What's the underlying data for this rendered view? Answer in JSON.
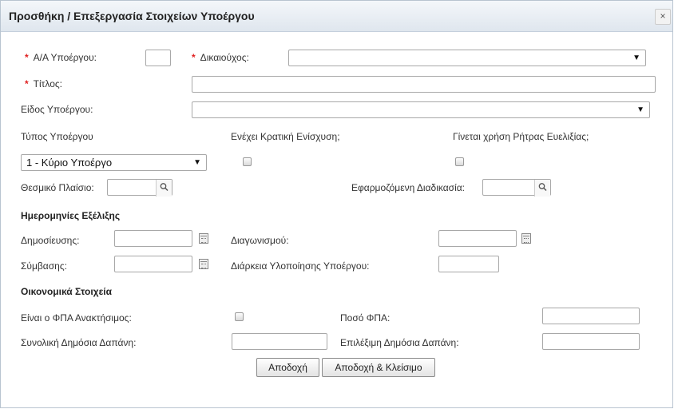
{
  "dialog": {
    "title": "Προσθήκη / Επεξεργασία Στοιχείων Υποέργου",
    "close": "×"
  },
  "fields": {
    "aa": {
      "label": "Α/Α Υποέργου:",
      "required": "*",
      "value": ""
    },
    "beneficiary": {
      "label": "Δικαιούχος:",
      "required": "*",
      "value": ""
    },
    "title": {
      "label": "Τίτλος:",
      "required": "*",
      "value": ""
    },
    "subproject_kind": {
      "label": "Είδος Υποέργου:",
      "value": ""
    },
    "subproject_type": {
      "label": "Τύπος Υποέργου",
      "value": "1 - Κύριο Υποέργο"
    },
    "state_aid": {
      "label": "Ενέχει Κρατική Ενίσχυση;",
      "checked": false
    },
    "flex_clause": {
      "label": "Γίνεται χρήση Ρήτρας Ευελιξίας;",
      "checked": false
    },
    "framework": {
      "label": "Θεσμικό Πλαίσιο:",
      "value": ""
    },
    "procedure": {
      "label": "Εφαρμοζόμενη Διαδικασία:",
      "value": ""
    }
  },
  "dates": {
    "heading": "Ημερομηνίες Εξέλιξης",
    "publication": {
      "label": "Δημοσίευσης:",
      "value": ""
    },
    "tender": {
      "label": "Διαγωνισμού:",
      "value": ""
    },
    "contract": {
      "label": "Σύμβασης:",
      "value": ""
    },
    "duration": {
      "label": "Διάρκεια Υλοποίησης Υποέργου:",
      "value": ""
    }
  },
  "financial": {
    "heading": "Οικονομικά Στοιχεία",
    "vat_recoverable": {
      "label": "Είναι ο ΦΠΑ Ανακτήσιμος:",
      "checked": false
    },
    "vat_amount": {
      "label": "Ποσό ΦΠΑ:",
      "value": ""
    },
    "total_public": {
      "label": "Συνολική Δημόσια Δαπάνη:",
      "value": ""
    },
    "eligible_public": {
      "label": "Επιλέξιμη Δημόσια Δαπάνη:",
      "value": ""
    }
  },
  "buttons": {
    "accept": "Αποδοχή",
    "accept_close": "Αποδοχή & Κλείσιμο"
  },
  "icons": {
    "dropdown": "▼",
    "lookup": "search-icon",
    "calendar": "calendar-icon"
  },
  "colors": {
    "required": "#e02020",
    "title_bar": "#dfe6ee"
  }
}
